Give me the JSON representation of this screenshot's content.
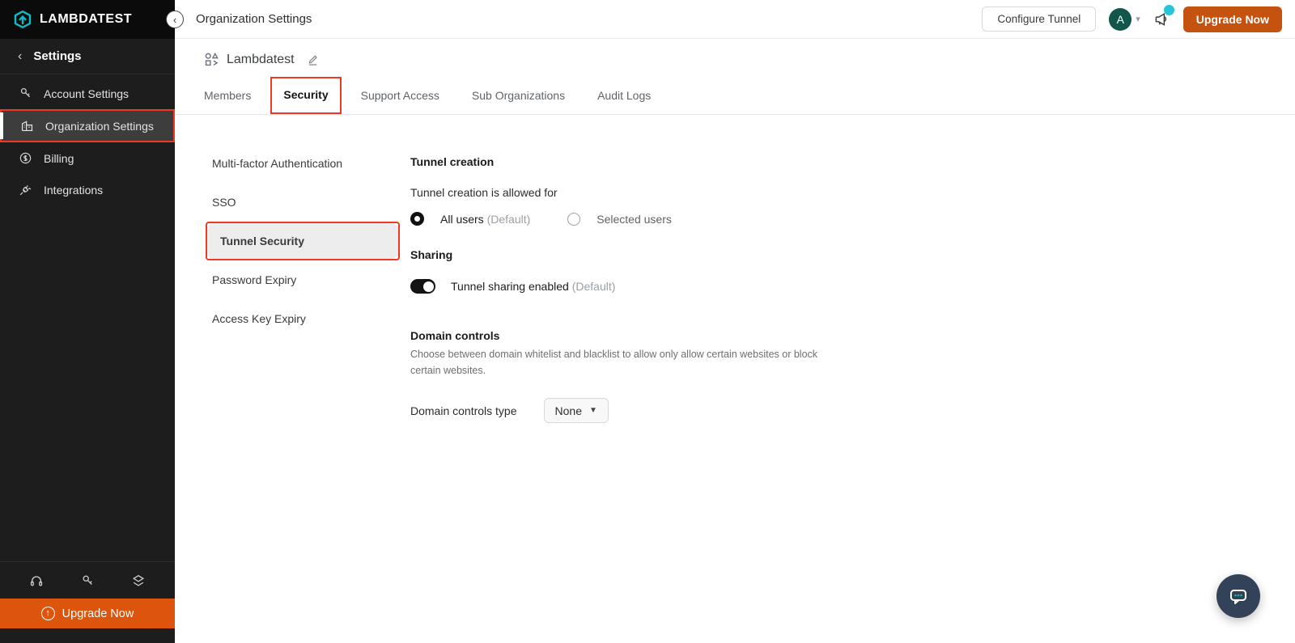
{
  "sidebar": {
    "logo_text": "LAMBDATEST",
    "header": "Settings",
    "items": [
      {
        "label": "Account Settings",
        "icon": "key-icon"
      },
      {
        "label": "Organization Settings",
        "icon": "building-icon",
        "active": true
      },
      {
        "label": "Billing",
        "icon": "dollar-circle-icon"
      },
      {
        "label": "Integrations",
        "icon": "plug-icon"
      }
    ],
    "footer_icons": [
      "headset-icon",
      "key-icon",
      "layers-icon"
    ],
    "upgrade_label": "Upgrade Now"
  },
  "header": {
    "title": "Organization Settings",
    "configure_tunnel_label": "Configure Tunnel",
    "avatar_initial": "A",
    "upgrade_label": "Upgrade Now"
  },
  "org": {
    "name": "Lambdatest"
  },
  "tabs": [
    {
      "label": "Members",
      "active": false
    },
    {
      "label": "Security",
      "active": true,
      "annotated": true
    },
    {
      "label": "Support Access",
      "active": false
    },
    {
      "label": "Sub Organizations",
      "active": false
    },
    {
      "label": "Audit Logs",
      "active": false
    }
  ],
  "security_menu": [
    {
      "label": "Multi-factor Authentication",
      "active": false
    },
    {
      "label": "SSO",
      "active": false
    },
    {
      "label": "Tunnel Security",
      "active": true,
      "annotated": true
    },
    {
      "label": "Password Expiry",
      "active": false
    },
    {
      "label": "Access Key Expiry",
      "active": false
    }
  ],
  "content": {
    "tunnel_creation": {
      "heading": "Tunnel creation",
      "subheading": "Tunnel creation is allowed for",
      "options": [
        {
          "label": "All users",
          "suffix": "(Default)",
          "selected": true
        },
        {
          "label": "Selected users",
          "suffix": "",
          "selected": false
        }
      ]
    },
    "sharing": {
      "heading": "Sharing",
      "toggle_label": "Tunnel sharing enabled",
      "toggle_suffix": "(Default)",
      "enabled": true
    },
    "domain_controls": {
      "heading": "Domain controls",
      "description": "Choose between domain whitelist and blacklist to allow only allow certain websites or block certain websites.",
      "type_label": "Domain controls type",
      "type_value": "None"
    }
  },
  "colors": {
    "brand_teal": "#0ebac5",
    "header_upgrade_orange": "#c5520f",
    "sidebar_upgrade_orange": "#dd550c",
    "annotation_red": "#ee3a24",
    "avatar_green": "#12564a",
    "notification_cyan": "#29c4d8",
    "chat_fab_navy": "#334258"
  }
}
